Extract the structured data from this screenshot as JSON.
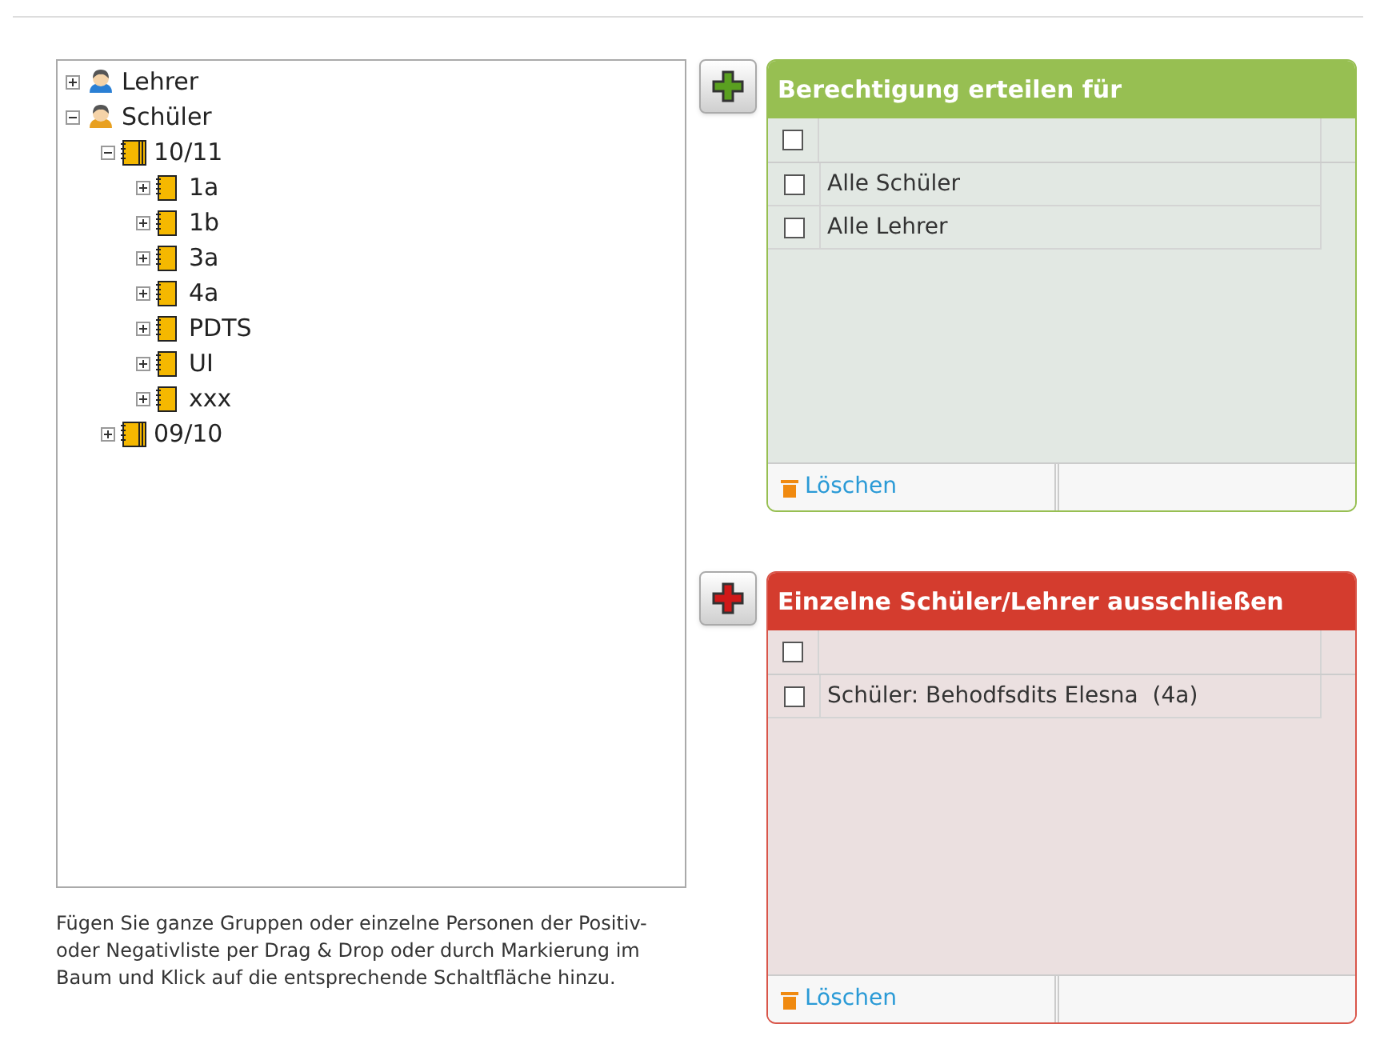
{
  "tree": [
    {
      "label": "Lehrer",
      "kind": "teachers",
      "expanded": false
    },
    {
      "label": "Schüler",
      "kind": "students",
      "expanded": true,
      "children": [
        {
          "label": "10/11",
          "kind": "year",
          "expanded": true,
          "children": [
            {
              "label": "1a",
              "kind": "class",
              "expanded": false
            },
            {
              "label": "1b",
              "kind": "class",
              "expanded": false
            },
            {
              "label": "3a",
              "kind": "class",
              "expanded": false
            },
            {
              "label": "4a",
              "kind": "class",
              "expanded": false
            },
            {
              "label": "PDTS",
              "kind": "class",
              "expanded": false
            },
            {
              "label": "UI",
              "kind": "class",
              "expanded": false
            },
            {
              "label": "xxx",
              "kind": "class",
              "expanded": false
            }
          ]
        },
        {
          "label": "09/10",
          "kind": "year",
          "expanded": false
        }
      ]
    }
  ],
  "help_text": "Fügen Sie ganze Gruppen oder einzelne Personen der Positiv- oder Negativliste per Drag & Drop oder durch Markierung im Baum und Klick auf die entsprechende Schaltfläche hinzu.",
  "panels": [
    {
      "kind": "allow",
      "title": "Berechtigung erteilen für",
      "all_checked": false,
      "rows": [
        {
          "label": "Alle Schüler",
          "checked": false
        },
        {
          "label": "Alle Lehrer",
          "checked": false
        }
      ],
      "delete_label": "Löschen"
    },
    {
      "kind": "deny",
      "title": "Einzelne Schüler/Lehrer ausschließen",
      "all_checked": false,
      "rows": [
        {
          "label": "Schüler: Behodfsdits Elesna  (4a)",
          "checked": false
        }
      ],
      "delete_label": "Löschen"
    }
  ]
}
